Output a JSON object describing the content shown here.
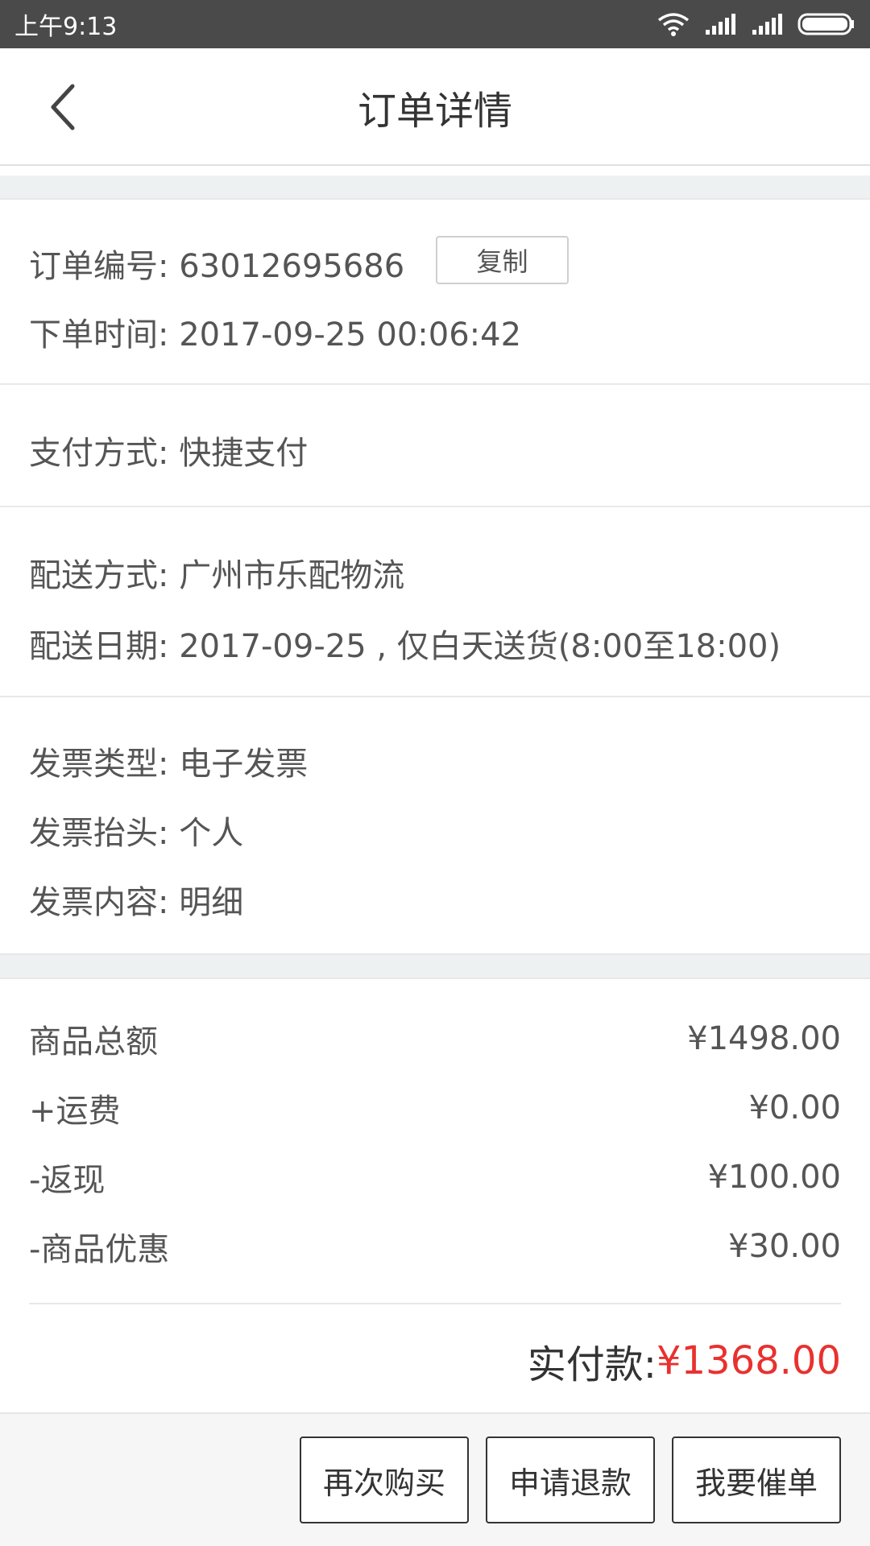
{
  "status_bar": {
    "time": "上午9:13"
  },
  "header": {
    "title": "订单详情",
    "back_icon": "chevron-left-icon"
  },
  "order": {
    "number_label": "订单编号:",
    "number_value": "63012695686",
    "copy_label": "复制",
    "time_label": "下单时间:",
    "time_value": "2017-09-25 00:06:42"
  },
  "payment": {
    "method_label": "支付方式:",
    "method_value": "快捷支付"
  },
  "delivery": {
    "method_label": "配送方式:",
    "method_value": "广州市乐配物流",
    "date_label": "配送日期:",
    "date_value": "2017-09-25 , 仅白天送货(8:00至18:00)"
  },
  "invoice": {
    "type_label": "发票类型:",
    "type_value": "电子发票",
    "title_label": "发票抬头:",
    "title_value": "个人",
    "content_label": "发票内容:",
    "content_value": "明细"
  },
  "costs": [
    {
      "label": "商品总额",
      "value": "¥1498.00"
    },
    {
      "label": "+运费",
      "value": "¥0.00"
    },
    {
      "label": "-返现",
      "value": "¥100.00"
    },
    {
      "label": "-商品优惠",
      "value": "¥30.00"
    }
  ],
  "total": {
    "label": "实付款:",
    "value": "¥1368.00"
  },
  "actions": {
    "buy_again": "再次购买",
    "refund": "申请退款",
    "urge": "我要催单"
  },
  "colors": {
    "total_price": "#e8312f",
    "status_bar": "#4a4a4a"
  }
}
